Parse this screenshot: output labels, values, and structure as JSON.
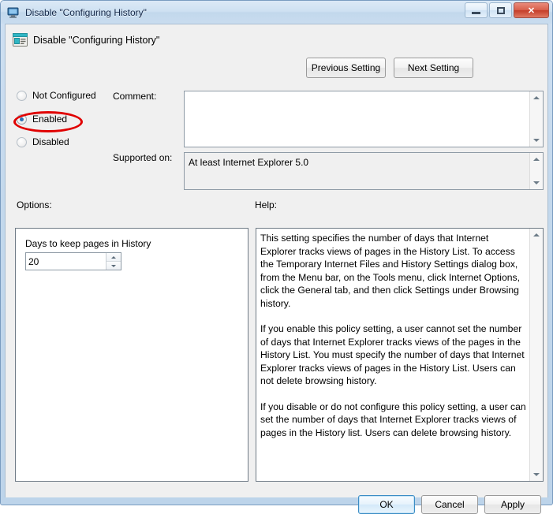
{
  "window": {
    "title": "Disable \"Configuring History\"",
    "icon": "policy-monitor-icon",
    "controls": {
      "minimize": "Minimize",
      "maximize": "Maximize",
      "close": "Close",
      "close_glyph": "✕"
    }
  },
  "header": {
    "icon": "policy-setting-icon",
    "title": "Disable \"Configuring History\"",
    "previous_setting": "Previous Setting",
    "next_setting": "Next Setting"
  },
  "state": {
    "options": [
      {
        "label": "Not Configured",
        "selected": false
      },
      {
        "label": "Enabled",
        "selected": true
      },
      {
        "label": "Disabled",
        "selected": false
      }
    ],
    "selected_value": "Enabled",
    "annotation_color": "#e00000"
  },
  "comment": {
    "label": "Comment:",
    "value": "",
    "placeholder": ""
  },
  "supported": {
    "label": "Supported on:",
    "value": "At least Internet Explorer 5.0"
  },
  "options_pane": {
    "label": "Options:",
    "setting_label": "Days to keep pages in History",
    "setting_value": "20"
  },
  "help_pane": {
    "label": "Help:",
    "paragraphs": [
      "This setting specifies the number of days that Internet Explorer tracks views of pages in the History List. To access the Temporary Internet Files and History Settings dialog box, from the Menu bar, on the Tools menu, click Internet Options, click the General tab, and then click Settings under Browsing history.",
      "If you enable this policy setting, a user cannot set the number of days that Internet Explorer tracks views of the pages in the History List. You must specify the number of days that Internet Explorer tracks views of pages in the History List. Users can not delete browsing history.",
      "If you disable or do not configure this policy setting, a user can set the number of days that Internet Explorer tracks views of pages in the History list. Users can delete browsing history."
    ]
  },
  "footer": {
    "ok": "OK",
    "cancel": "Cancel",
    "apply": "Apply"
  }
}
